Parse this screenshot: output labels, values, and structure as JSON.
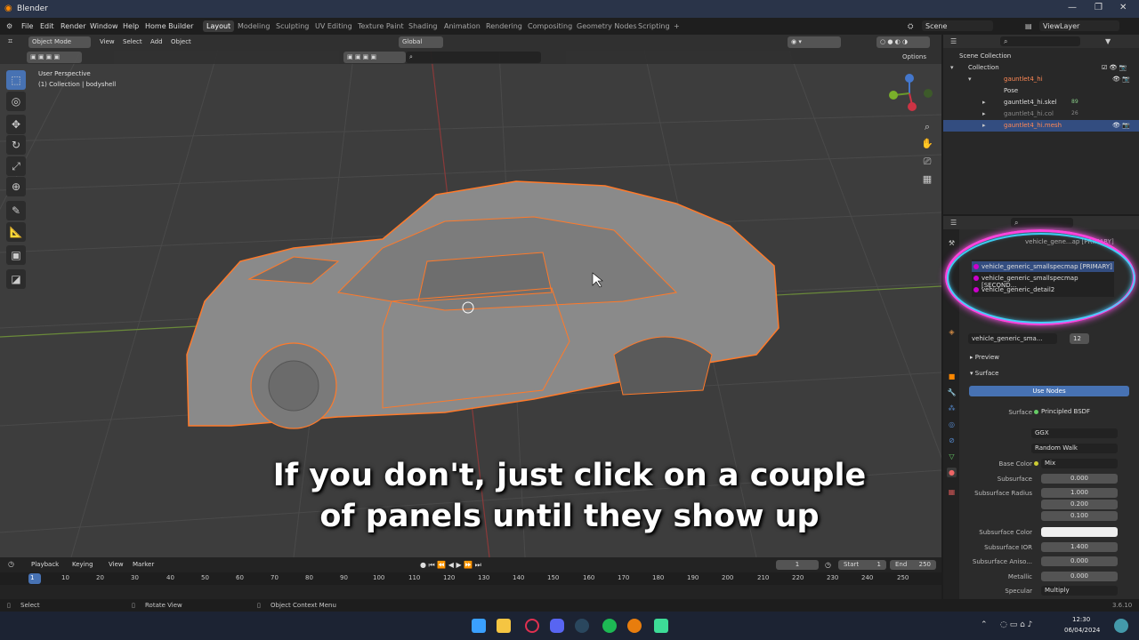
{
  "window": {
    "title": "Blender",
    "controls": [
      "—",
      "❐",
      "✕"
    ]
  },
  "menu": {
    "items": [
      "File",
      "Edit",
      "Render",
      "Window",
      "Help",
      "Home Builder"
    ]
  },
  "workspaces": [
    "Layout",
    "Modeling",
    "Sculpting",
    "UV Editing",
    "Texture Paint",
    "Shading",
    "Animation",
    "Rendering",
    "Compositing",
    "Geometry Nodes",
    "Scripting",
    "+"
  ],
  "scene": {
    "scene_label": "Scene",
    "viewlayer_label": "ViewLayer"
  },
  "viewport": {
    "mode": "Object Mode",
    "header_menus": [
      "View",
      "Select",
      "Add",
      "Object"
    ],
    "transform": "Global",
    "options": "Options",
    "info_line1": "User Perspective",
    "info_line2": "(1) Collection | bodyshell"
  },
  "subtitle": {
    "line1": "If you don't, just click on a couple",
    "line2": "of panels until they show up"
  },
  "outliner": {
    "rows": [
      {
        "label": "Scene Collection",
        "badge": ""
      },
      {
        "label": "Collection",
        "badge": ""
      },
      {
        "label": "gauntlet4_hi",
        "badge": ""
      },
      {
        "label": "Pose",
        "badge": ""
      },
      {
        "label": "gauntlet4_hi.skel",
        "badge": "89"
      },
      {
        "label": "gauntlet4_hi.col",
        "badge": "26"
      },
      {
        "label": "gauntlet4_hi.mesh",
        "badge": ""
      }
    ]
  },
  "properties": {
    "breadcrumb": "vehicle_gene...ap [PRIMARY]",
    "material_slots": [
      "vehicle_generic_smallspecmap [PRIMARY]",
      "vehicle_generic_smallspecmap [SECOND...",
      "vehicle_generic_detail2"
    ],
    "material_name": "vehicle_generic_sma...",
    "material_users": "12",
    "preview": "Preview",
    "surface": "Surface",
    "use_nodes": "Use Nodes",
    "surface_shader": "Principled BSDF",
    "distribution": "GGX",
    "subsurface_method": "Random Walk",
    "fields": [
      {
        "label": "Surface",
        "value": "Principled BSDF"
      },
      {
        "label": "Base Color",
        "value": "Mix"
      },
      {
        "label": "Subsurface",
        "value": "0.000"
      },
      {
        "label": "Subsurface Radius",
        "value": "1.000"
      },
      {
        "label": "",
        "value": "0.200"
      },
      {
        "label": "",
        "value": "0.100"
      },
      {
        "label": "Subsurface Color",
        "value": ""
      },
      {
        "label": "Subsurface IOR",
        "value": "1.400"
      },
      {
        "label": "Subsurface Aniso...",
        "value": "0.000"
      },
      {
        "label": "Metallic",
        "value": "0.000"
      },
      {
        "label": "Specular",
        "value": "Multiply"
      }
    ]
  },
  "timeline": {
    "menus": [
      "Playback",
      "Keying",
      "View",
      "Marker"
    ],
    "current_frame": "1",
    "start_label": "Start",
    "start": "1",
    "end_label": "End",
    "end": "250",
    "ticks": [
      "1",
      "10",
      "20",
      "30",
      "40",
      "50",
      "60",
      "70",
      "80",
      "90",
      "100",
      "110",
      "120",
      "130",
      "140",
      "150",
      "160",
      "170",
      "180",
      "190",
      "200",
      "210",
      "220",
      "230",
      "240",
      "250"
    ]
  },
  "status": {
    "select": "Select",
    "rotate": "Rotate View",
    "context": "Object Context Menu",
    "version": "3.6.10"
  },
  "taskbar": {
    "time": "12:30",
    "date": "06/04/2024"
  },
  "colors": {
    "accent": "#4772b3",
    "outline": "#ff7a2a",
    "ring_pink": "#ff44dd",
    "ring_cyan": "#3fd8ff"
  }
}
